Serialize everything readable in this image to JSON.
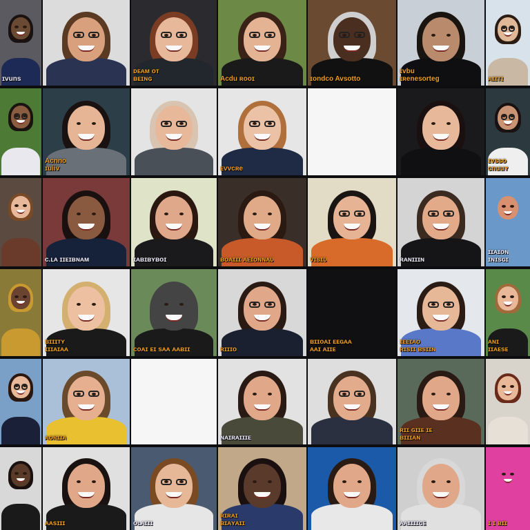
{
  "window": {
    "title": ""
  },
  "colors": {
    "background": "#0d0d0f",
    "name_label": "#f0a020"
  },
  "tiles": [
    {
      "row": 0,
      "col": 0,
      "label": "ɪvuns",
      "label_color": "white",
      "bg": "#5a5a60",
      "skin": "#6b4a34",
      "hair": "#1a1210",
      "shirt": "#1c2a55",
      "glasses": false
    },
    {
      "row": 0,
      "col": 1,
      "label": "",
      "bg": "#dcdcdc",
      "skin": "#d9a07e",
      "hair": "#5a3a22",
      "shirt": "#2a3352",
      "glasses": true
    },
    {
      "row": 0,
      "col": 2,
      "label": "ᴅᴇᴀᴍ ᴏᴛ\nʙᴇɪɴɢ",
      "bg": "#2b2b2f",
      "skin": "#e8b89a",
      "hair": "#7a3c22",
      "shirt": "#22272e",
      "glasses": true
    },
    {
      "row": 0,
      "col": 3,
      "label": "Acdu ʀᴏᴏɪ",
      "bg": "#6c8a46",
      "skin": "#e3b394",
      "hair": "#3a2216",
      "shirt": "#1a1a1a",
      "glasses": true
    },
    {
      "row": 0,
      "col": 4,
      "label": "ɪondco Avsotto",
      "bg": "#6b4a32",
      "skin": "#4a2e20",
      "hair": "#cfcfcf",
      "shirt": "#111111",
      "glasses": true
    },
    {
      "row": 0,
      "col": 5,
      "label": "ɪvbu\nɪʀenesorteg",
      "bg": "#c9cfd6",
      "skin": "#b98a6c",
      "hair": "#1a1410",
      "shirt": "#0f0f12",
      "glasses": false
    },
    {
      "row": 0,
      "col": 6,
      "label": "ᴀɪɪᴛɪ",
      "bg": "#d8e2ea",
      "skin": "#e0b898",
      "hair": "#2a1c12",
      "shirt": "#c8b8a4",
      "glasses": true
    },
    {
      "row": 1,
      "col": 0,
      "label": "",
      "bg": "#4d7a34",
      "skin": "#8a5c40",
      "hair": "#1a1410",
      "shirt": "#e8e8ee",
      "glasses": true
    },
    {
      "row": 1,
      "col": 1,
      "label": "Acnno\nɪuiiv",
      "bg": "#2c3e48",
      "skin": "#e6b596",
      "hair": "#1a1210",
      "shirt": "#6a7078",
      "glasses": false
    },
    {
      "row": 1,
      "col": 2,
      "label": "",
      "bg": "#e4e4e4",
      "skin": "#e8b89a",
      "hair": "#d8c4b0",
      "shirt": "#4a5058",
      "glasses": true
    },
    {
      "row": 1,
      "col": 3,
      "label": "ᴇvvcʀe",
      "bg": "#e6e6e6",
      "skin": "#ecc2a6",
      "hair": "#b0703c",
      "shirt": "#1f2a44",
      "glasses": true
    },
    {
      "row": 1,
      "col": 4,
      "label": "",
      "bg": "#f6f6f6",
      "skin": "#f6f6f6",
      "hair": "#f6f6f6",
      "shirt": "#f6f6f6",
      "glasses": false,
      "blank": true
    },
    {
      "row": 1,
      "col": 5,
      "label": "",
      "bg": "#1a1a1c",
      "skin": "#e8b89a",
      "hair": "#1a1010",
      "shirt": "#101012",
      "glasses": false
    },
    {
      "row": 1,
      "col": 6,
      "label": "ɪvsso\nᴄnuuʏ",
      "bg": "#2c3a40",
      "skin": "#c99474",
      "hair": "#1a1210",
      "shirt": "#efefef",
      "glasses": true
    },
    {
      "row": 2,
      "col": 0,
      "label": "",
      "bg": "#5a4a40",
      "skin": "#e8b89a",
      "hair": "#7a4a26",
      "shirt": "#6a3a2a",
      "glasses": false
    },
    {
      "row": 2,
      "col": 1,
      "label": "ᴄ.ʟᴀ ɪɪᴇɪʙɴᴀᴍ",
      "label_color": "white",
      "bg": "#7a3a3a",
      "skin": "#8a5a40",
      "hair": "#1a1010",
      "shirt": "#16213a",
      "glasses": false
    },
    {
      "row": 2,
      "col": 2,
      "label": "ɪᴀʙɪʙʏʙᴏɪ",
      "label_color": "white",
      "bg": "#dfe3c8",
      "skin": "#e0a88a",
      "hair": "#2a1810",
      "shirt": "#1a1a1c",
      "glasses": false
    },
    {
      "row": 2,
      "col": 3,
      "label": "ʙᴏᴀɪɪɪ ᴀᴇɪᴏɴɴᴀᴜ",
      "bg": "#3a2e28",
      "skin": "#e0aa88",
      "hair": "#2a1a12",
      "shirt": "#c85a2a",
      "glasses": false
    },
    {
      "row": 2,
      "col": 4,
      "label": "ᴠɪsɪᴜ",
      "bg": "#e2dcc6",
      "skin": "#e6b494",
      "hair": "#1a1412",
      "shirt": "#d86a2a",
      "glasses": true
    },
    {
      "row": 2,
      "col": 5,
      "label": "ʀᴀɴɪɪɪɴ",
      "label_color": "white",
      "bg": "#d4d4d4",
      "skin": "#e2aa88",
      "hair": "#3a2a20",
      "shirt": "#151517",
      "glasses": true
    },
    {
      "row": 2,
      "col": 6,
      "label": "ɪɪᴀɪᴏɴ\nɪɴɪsɢɪ",
      "label_color": "white",
      "bg": "#6a98c8",
      "skin": "#d89070",
      "hair": "#6a98c8",
      "shirt": "#6a98c8",
      "glasses": false
    },
    {
      "row": 3,
      "col": 0,
      "label": "",
      "bg": "#8a7a38",
      "skin": "#6a4430",
      "hair": "#c89a30",
      "shirt": "#c89a30",
      "glasses": false
    },
    {
      "row": 3,
      "col": 1,
      "label": "ʙɪɪɪᴛʏ\nɪɪɪᴀɪᴀᴀ",
      "bg": "#e6e6e6",
      "skin": "#ecc0a0",
      "hair": "#d4b070",
      "shirt": "#1a1a1a",
      "glasses": false
    },
    {
      "row": 3,
      "col": 2,
      "label": "ᴄᴏᴀɪ ᴇɪ sᴀᴀ ᴀᴀʙɪɪ",
      "bg": "#6a8a5a",
      "skin": "#444444",
      "hair": "#444444",
      "shirt": "#1a1a1a",
      "glasses": false
    },
    {
      "row": 3,
      "col": 3,
      "label": "ʀɪɪɪᴏ",
      "bg": "#d8d8d8",
      "skin": "#e0a888",
      "hair": "#2a1a14",
      "shirt": "#1a2030",
      "glasses": true
    },
    {
      "row": 3,
      "col": 4,
      "label": "ʙɪɪᴏᴀɪ ᴇᴇɢᴀᴀ\nᴀᴀɪ ᴀɪɪᴇ",
      "bg": "#101012",
      "skin": "#101012",
      "hair": "#101012",
      "shirt": "#101012",
      "glasses": false,
      "dark": true
    },
    {
      "row": 3,
      "col": 5,
      "label": "ɪᴇᴇɪᴀᴏ\nʀɪsɪɪ ʙsɪɪɴ",
      "bg": "#e4e8ec",
      "skin": "#e6b898",
      "hair": "#2a1c14",
      "shirt": "#5a78c8",
      "glasses": true
    },
    {
      "row": 3,
      "col": 6,
      "label": "ᴀɴɪ\nɪɪᴀᴇsᴇ",
      "bg": "#5a8a4a",
      "skin": "#e8b898",
      "hair": "#a06a3a",
      "shirt": "#1a1a1a",
      "glasses": false
    },
    {
      "row": 4,
      "col": 0,
      "label": "",
      "bg": "#7aa0c8",
      "skin": "#e8b898",
      "hair": "#2a1810",
      "shirt": "#1a2038",
      "glasses": true
    },
    {
      "row": 4,
      "col": 1,
      "label": "ᴀᴏʀɪɪᴀ",
      "bg": "#aac0d8",
      "skin": "#e6b090",
      "hair": "#6a4a2a",
      "shirt": "#e8c030",
      "glasses": true
    },
    {
      "row": 4,
      "col": 2,
      "label": "",
      "bg": "#f6f6f6",
      "skin": "#f6f6f6",
      "hair": "#f6f6f6",
      "shirt": "#f6f6f6",
      "glasses": false,
      "blank": true
    },
    {
      "row": 4,
      "col": 3,
      "label": "ɴᴀɪʀᴀɪɪɪᴇ",
      "label_color": "white",
      "bg": "#e2e2e2",
      "skin": "#e0a888",
      "hair": "#2a1a14",
      "shirt": "#4a4a3a",
      "glasses": false
    },
    {
      "row": 4,
      "col": 4,
      "label": "",
      "bg": "#dedede",
      "skin": "#e2ac8c",
      "hair": "#4a3220",
      "shirt": "#2a3040",
      "glasses": true
    },
    {
      "row": 4,
      "col": 5,
      "label": "ʀɪɪ ɢɪɪᴇ ɪᴇ\nʙɪɪɪᴀɴ",
      "bg": "#5a6a5a",
      "skin": "#e0a888",
      "hair": "#2a1a14",
      "shirt": "#5a3020",
      "glasses": false
    },
    {
      "row": 4,
      "col": 6,
      "label": "",
      "bg": "#d8d4cc",
      "skin": "#e8b898",
      "hair": "#6a2a1a",
      "shirt": "#e6e0d6",
      "glasses": false
    },
    {
      "row": 5,
      "col": 0,
      "label": "",
      "bg": "#d8d8d8",
      "skin": "#5a3a28",
      "hair": "#1a1010",
      "shirt": "#1a1a1a",
      "glasses": false
    },
    {
      "row": 5,
      "col": 1,
      "label": "ᴀᴀsɪɪɪ",
      "bg": "#e0e0e0",
      "skin": "#e0a888",
      "hair": "#1a1210",
      "shirt": "#1a1a1a",
      "glasses": false
    },
    {
      "row": 5,
      "col": 2,
      "label": "ᴏʟᴀɪɪɪ",
      "label_color": "white",
      "bg": "#4a5a70",
      "skin": "#e6b898",
      "hair": "#7a4a22",
      "shirt": "#e6e6e6",
      "glasses": true
    },
    {
      "row": 5,
      "col": 3,
      "label": "ʀɪʀᴀɪ\nʙɪᴀʏᴀɪɪ",
      "bg": "#c0a888",
      "skin": "#5a3a2a",
      "hair": "#1a1010",
      "shirt": "#2a3a6a",
      "glasses": false
    },
    {
      "row": 5,
      "col": 4,
      "label": "",
      "bg": "#1a5aa8",
      "skin": "#e0a888",
      "hair": "#2a1a14",
      "shirt": "#e8e8e8",
      "glasses": false
    },
    {
      "row": 5,
      "col": 5,
      "label": "ᴀᴀɪɪɪɪᴄᴇ",
      "label_color": "white",
      "bg": "#cfcfcf",
      "skin": "#e0a888",
      "hair": "#d8d8d8",
      "shirt": "#e0e0e0",
      "glasses": false
    },
    {
      "row": 5,
      "col": 6,
      "label": "ɪ ɪ ʙɪɪ",
      "bg": "#e040a0",
      "skin": "#e040a0",
      "hair": "#e040a0",
      "shirt": "#e040a0",
      "glasses": false
    }
  ]
}
